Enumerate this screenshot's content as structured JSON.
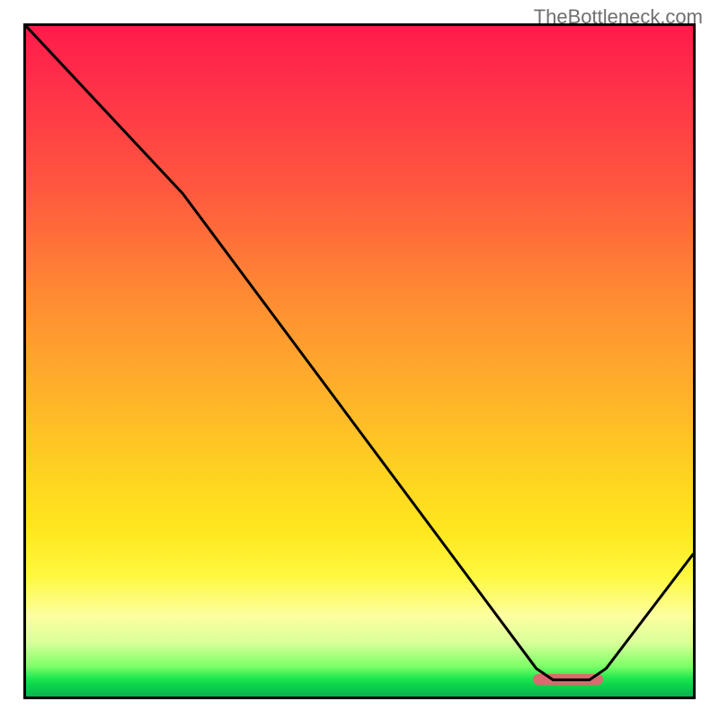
{
  "watermark": "TheBottleneck.com",
  "chart_data": {
    "type": "line",
    "title": "",
    "xlabel": "",
    "ylabel": "",
    "xlim": [
      0,
      100
    ],
    "ylim": [
      0,
      100
    ],
    "grid": false,
    "legend": false,
    "series": [
      {
        "name": "curve",
        "points_percent": [
          [
            0.0,
            0.0
          ],
          [
            23.5,
            25.0
          ],
          [
            76.5,
            95.8
          ],
          [
            79.0,
            97.5
          ],
          [
            84.5,
            97.5
          ],
          [
            87.0,
            95.8
          ],
          [
            100.0,
            78.8
          ]
        ]
      }
    ],
    "marker": {
      "x_start_percent": 76.0,
      "x_end_percent": 86.5,
      "y_percent": 97.5
    },
    "gradient_stops": [
      {
        "pct": 0,
        "color": "#ff1b4a"
      },
      {
        "pct": 8,
        "color": "#ff2e49"
      },
      {
        "pct": 25,
        "color": "#ff5a3e"
      },
      {
        "pct": 40,
        "color": "#ff8a33"
      },
      {
        "pct": 55,
        "color": "#ffb22a"
      },
      {
        "pct": 67,
        "color": "#ffd321"
      },
      {
        "pct": 75,
        "color": "#ffe61d"
      },
      {
        "pct": 82,
        "color": "#fff83f"
      },
      {
        "pct": 88,
        "color": "#fdffa0"
      },
      {
        "pct": 92,
        "color": "#d9ff9a"
      },
      {
        "pct": 95.5,
        "color": "#7dff67"
      },
      {
        "pct": 97.2,
        "color": "#23e84f"
      },
      {
        "pct": 98.3,
        "color": "#0cd24c"
      },
      {
        "pct": 99.1,
        "color": "#0cc54d"
      },
      {
        "pct": 100,
        "color": "#0bb34e"
      }
    ]
  }
}
